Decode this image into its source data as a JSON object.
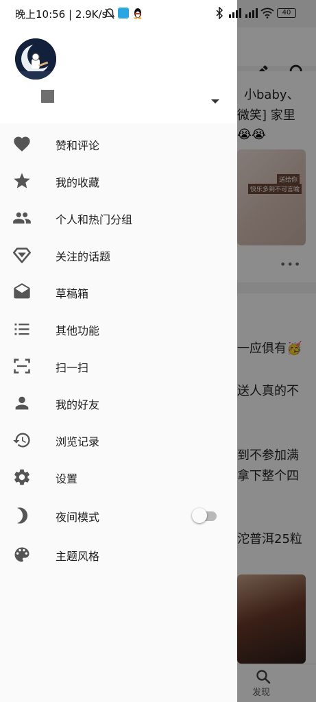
{
  "status_bar": {
    "text": "晚上10:56 | 2.9K/s",
    "battery": "40"
  },
  "background": {
    "posts": [
      {
        "line1": "小baby、",
        "line2": "微笑]  家里",
        "image_caption_1": "送给你",
        "image_caption_2": "快乐多到不可言喻"
      },
      {
        "line1": "一应俱有🥳",
        "line2": "送人真的不"
      },
      {
        "line1": "到不参加满",
        "line2": "拿下整个四"
      },
      {
        "line1": "沱普洱25粒"
      }
    ],
    "bottom_nav": {
      "discover_label": "发现"
    }
  },
  "drawer": {
    "menu": [
      {
        "id": "likes",
        "label": "赞和评论",
        "icon": "heart-icon"
      },
      {
        "id": "favorites",
        "label": "我的收藏",
        "icon": "star-icon"
      },
      {
        "id": "groups",
        "label": "个人和热门分组",
        "icon": "people-icon"
      },
      {
        "id": "topics",
        "label": "关注的话题",
        "icon": "diamond-icon"
      },
      {
        "id": "drafts",
        "label": "草稿箱",
        "icon": "drafts-icon"
      },
      {
        "id": "more",
        "label": "其他功能",
        "icon": "list-icon"
      },
      {
        "id": "scan",
        "label": "扫一扫",
        "icon": "scan-icon"
      },
      {
        "id": "friends",
        "label": "我的好友",
        "icon": "person-icon"
      },
      {
        "id": "history",
        "label": "浏览记录",
        "icon": "history-icon"
      },
      {
        "id": "settings",
        "label": "设置",
        "icon": "gear-icon"
      },
      {
        "id": "night",
        "label": "夜间模式",
        "icon": "moon-icon",
        "toggle": false
      },
      {
        "id": "theme",
        "label": "主题风格",
        "icon": "palette-icon"
      }
    ]
  },
  "colors": {
    "drawer_bg": "#fafafa",
    "icon": "#555555",
    "label": "#1e1e1e",
    "scrim": "rgba(0,0,0,0.45)"
  }
}
